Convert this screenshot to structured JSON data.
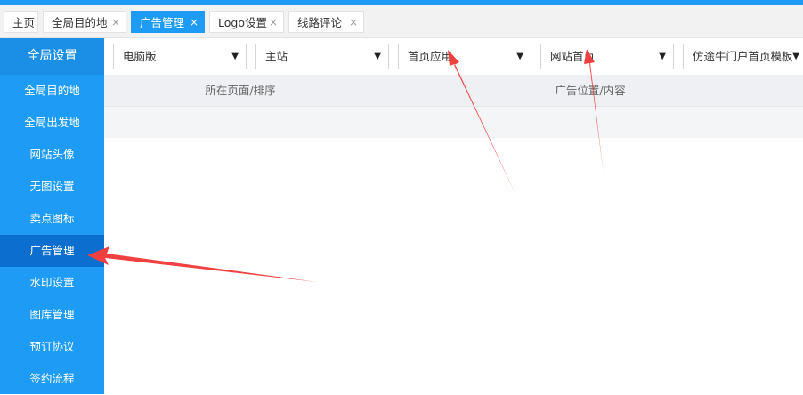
{
  "tabs": [
    {
      "label": "主页",
      "closable": false
    },
    {
      "label": "全局目的地",
      "closable": true
    },
    {
      "label": "广告管理",
      "closable": true,
      "active": true
    },
    {
      "label": "Logo设置",
      "closable": true
    },
    {
      "label": "线路评论",
      "closable": true
    }
  ],
  "close_glyph": "×",
  "sidebar": {
    "header": "全局设置",
    "items": [
      {
        "label": "全局目的地"
      },
      {
        "label": "全局出发地"
      },
      {
        "label": "网站头像"
      },
      {
        "label": "无图设置"
      },
      {
        "label": "卖点图标"
      },
      {
        "label": "广告管理",
        "active": true
      },
      {
        "label": "水印设置"
      },
      {
        "label": "图库管理"
      },
      {
        "label": "预订协议"
      },
      {
        "label": "签约流程"
      }
    ]
  },
  "filters": [
    {
      "value": "电脑版"
    },
    {
      "value": "主站"
    },
    {
      "value": "首页应用"
    },
    {
      "value": "网站首页"
    },
    {
      "value": "仿途牛门户首页模板"
    }
  ],
  "caret_glyph": "▼",
  "table": {
    "columns": [
      "所在页面/排序",
      "广告位置/内容"
    ]
  },
  "colors": {
    "accent": "#1e9bf5",
    "sidebar_active": "#0c6fd0",
    "annotation_arrow": "#f04040"
  }
}
